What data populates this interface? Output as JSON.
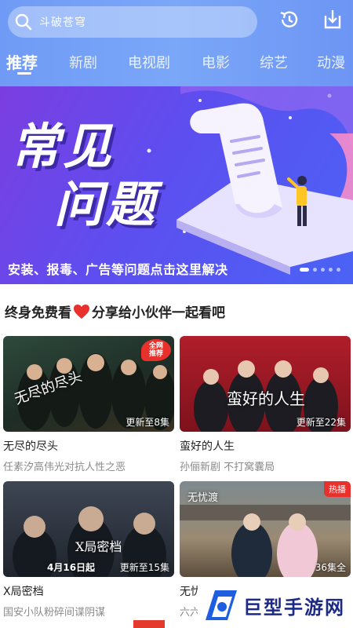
{
  "search": {
    "placeholder": "斗破苍穹"
  },
  "header": {
    "history_icon": "history-icon",
    "download_icon": "download-icon"
  },
  "tabs": [
    {
      "label": "推荐",
      "active": true
    },
    {
      "label": "新剧",
      "active": false
    },
    {
      "label": "电视剧",
      "active": false
    },
    {
      "label": "电影",
      "active": false
    },
    {
      "label": "综艺",
      "active": false
    },
    {
      "label": "动漫",
      "active": false
    }
  ],
  "banner": {
    "headline_line1": "常见",
    "headline_line2": "问题",
    "caption": "安装、报毒、广告等问题点击这里解决",
    "dots_total": 5,
    "dot_active": 0
  },
  "section": {
    "title_left": "终身免费看",
    "title_right": "分享给小伙伴一起看吧"
  },
  "cards": [
    {
      "name": "无尽的尽头",
      "desc": "任素汐高伟光对抗人性之恶",
      "episodes": "更新至8集",
      "badge": "全网\n推荐",
      "poster_title": "无尽的尽头"
    },
    {
      "name": "蛮好的人生",
      "desc": "孙俪新剧 不打窝囊局",
      "episodes": "更新至22集",
      "poster_title": "蛮好的人生"
    },
    {
      "name": "X局密档",
      "desc": "国安小队粉碎间谍阴谋",
      "episodes": "更新至15集",
      "date": "4月16日起",
      "poster_title": "X局密档"
    },
    {
      "name": "无忧渡",
      "desc": "六六",
      "episodes": "36集全",
      "badge": "热播",
      "poster_title": "无忧渡"
    }
  ],
  "watermark": {
    "text": "巨型手游网"
  },
  "colors": {
    "header": "#7aa7f8",
    "banner": "#5d4ef0",
    "accent_red": "#e8312d",
    "heart": "#e8312d"
  }
}
